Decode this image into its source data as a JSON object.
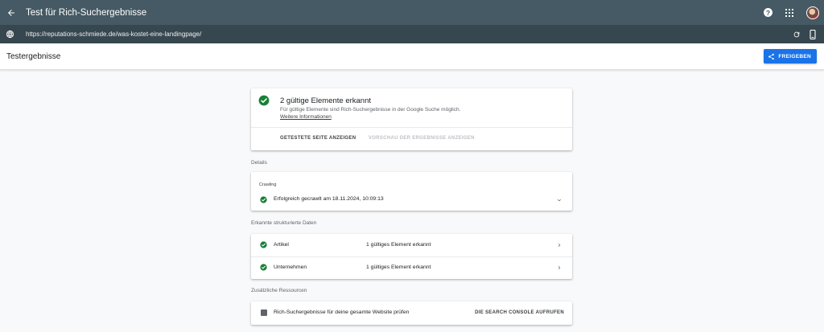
{
  "topbar": {
    "back_icon": "arrow-back-icon",
    "title": "Test für Rich-Suchergebnisse",
    "help_glyph": "?",
    "help_icon": "help-icon",
    "apps_icon": "apps-grid-icon",
    "avatar": "user-avatar"
  },
  "urlbar": {
    "globe_icon": "globe-icon",
    "url": "https://reputations-schmiede.de/was-kostet-eine-landingpage/",
    "refresh_icon": "refresh-icon",
    "device_icon": "smartphone-icon"
  },
  "subheader": {
    "title": "Testergebnisse",
    "share_label": "FREIGEBEN",
    "share_icon": "share-icon"
  },
  "summary": {
    "heading": "2 gültige Elemente erkannt",
    "description": "Für gültige Elemente sind Rich-Suchergebnisse in der Google Suche möglich.",
    "more_info": "Weitere Informationen",
    "action_view_page": "GETESTETE SEITE ANZEIGEN",
    "action_preview": "VORSCHAU DER ERGEBNISSE ANZEIGEN"
  },
  "details": {
    "section_label": "Details",
    "crawling_label": "Crawling",
    "crawling_status": "Erfolgreich gecrawlt am 18.11.2024, 10:09:13"
  },
  "structured_data": {
    "section_label": "Erkannte strukturierte Daten",
    "items": [
      {
        "name": "Artikel",
        "value": "1 gültiges Element erkannt"
      },
      {
        "name": "Unternehmen",
        "value": "1 gültiges Element erkannt"
      }
    ]
  },
  "resources": {
    "section_label": "Zusätzliche Ressourcen",
    "text": "Rich-Suchergebnisse für deine gesamte Website prüfen",
    "action": "DIE SEARCH CONSOLE AUFRUFEN"
  },
  "colors": {
    "topbar": "#455a64",
    "urlbar": "#37474f",
    "accent_blue": "#1a73e8",
    "success_green": "#188038"
  }
}
